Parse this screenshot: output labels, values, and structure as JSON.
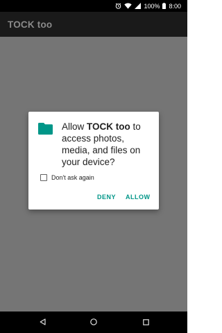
{
  "status_bar": {
    "battery_text": "100%",
    "clock": "8:00",
    "icons": [
      "alarm-icon",
      "wifi-icon",
      "signal-icon",
      "battery-icon"
    ]
  },
  "app_bar": {
    "title": "TOCK too"
  },
  "dialog": {
    "icon": "folder-icon",
    "message_prefix": "Allow ",
    "app_name": "TOCK too",
    "message_suffix": " to access photos, media, and files on your device?",
    "checkbox_label": "Don't ask again",
    "checkbox_checked": false,
    "deny_label": "DENY",
    "allow_label": "ALLOW",
    "accent_color": "#009688"
  },
  "nav_bar": {
    "buttons": [
      "back-icon",
      "home-icon",
      "recents-icon"
    ]
  }
}
